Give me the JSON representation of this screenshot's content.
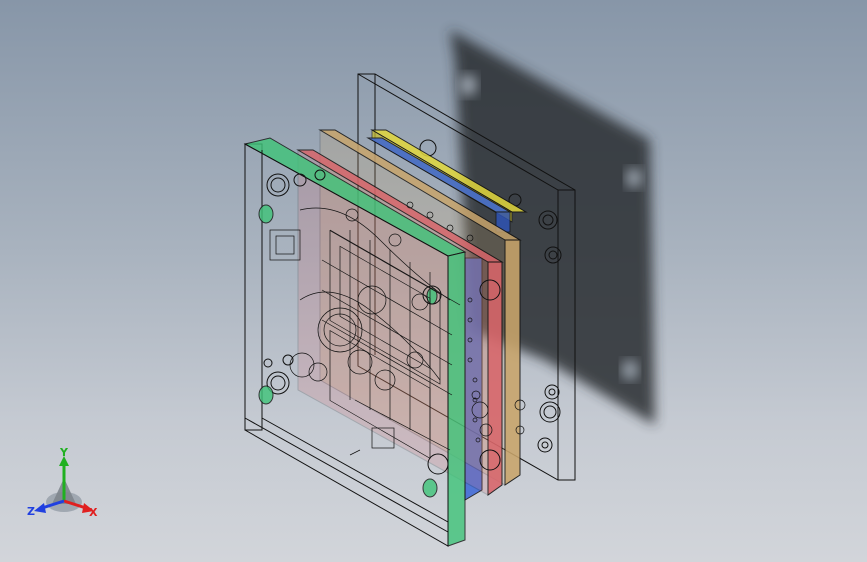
{
  "triad": {
    "x_label": "X",
    "y_label": "Y",
    "z_label": "Z"
  },
  "colors": {
    "background_top": "#8796a8",
    "background_bottom": "#d2d5da",
    "wireframe": "#111111",
    "plate_green": "#3fc479",
    "plate_red": "#d9656a",
    "plate_tan": "#c9a56b",
    "plate_blue": "#3b66d6",
    "plate_yellow": "#e2d83c",
    "shadow": "#2a2d31",
    "axis_x": "#e02020",
    "axis_y": "#20b020",
    "axis_z": "#2040e0"
  },
  "icons": {
    "triad": "view-orientation-triad-icon"
  }
}
